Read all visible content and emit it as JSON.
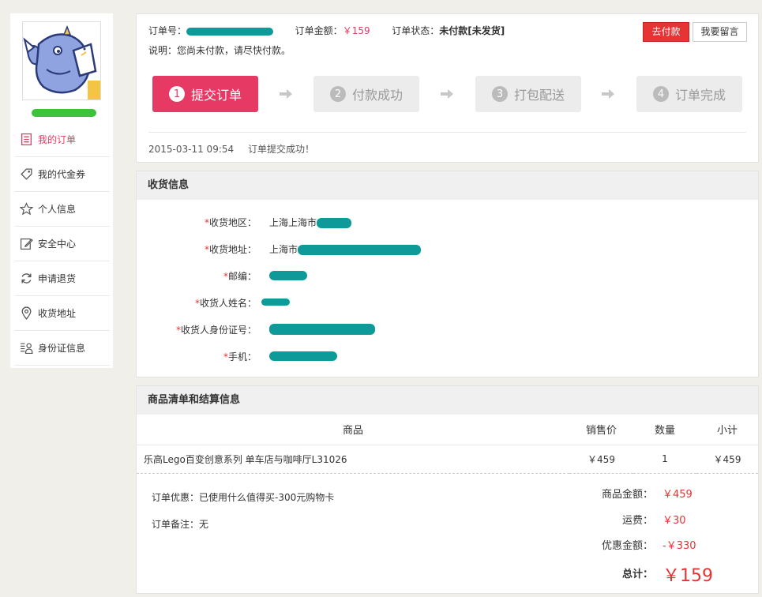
{
  "sidebar": {
    "items": [
      {
        "label": "我的订单",
        "icon": "order-list-icon",
        "active": true
      },
      {
        "label": "我的代金券",
        "icon": "coupon-tag-icon",
        "active": false
      },
      {
        "label": "个人信息",
        "icon": "star-icon",
        "active": false
      },
      {
        "label": "安全中心",
        "icon": "edit-icon",
        "active": false
      },
      {
        "label": "申请退货",
        "icon": "refresh-icon",
        "active": false
      },
      {
        "label": "收货地址",
        "icon": "location-pin-icon",
        "active": false
      },
      {
        "label": "身份证信息",
        "icon": "id-card-icon",
        "active": false
      }
    ]
  },
  "order": {
    "number_label": "订单号：",
    "amount_label": "订单金额：",
    "amount_value": "￥159",
    "status_label": "订单状态：",
    "status_value": "未付款[未发货]",
    "note": "说明：您尚未付款，请尽快付款。",
    "pay_button": "去付款",
    "message_button": "我要留言",
    "steps": [
      {
        "num": "1",
        "label": "提交订单",
        "active": true
      },
      {
        "num": "2",
        "label": "付款成功",
        "active": false
      },
      {
        "num": "3",
        "label": "打包配送",
        "active": false
      },
      {
        "num": "4",
        "label": "订单完成",
        "active": false
      }
    ],
    "log_time": "2015-03-11 09:54",
    "log_text": "订单提交成功！"
  },
  "address": {
    "title": "收货信息",
    "rows": [
      {
        "label": "收货地区：",
        "value": "上海上海市"
      },
      {
        "label": "收货地址：",
        "value": "上海市"
      },
      {
        "label": "邮编：",
        "value": ""
      },
      {
        "label": "收货人姓名：",
        "value": ""
      },
      {
        "label": "收货人身份证号：",
        "value": ""
      },
      {
        "label": "手机：",
        "value": ""
      }
    ]
  },
  "goods": {
    "title": "商品清单和结算信息",
    "headers": {
      "name": "商品",
      "price": "销售价",
      "qty": "数量",
      "subtotal": "小计"
    },
    "rows": [
      {
        "name": "乐高Lego百变创意系列 单车店与咖啡厅L31026",
        "price": "￥459",
        "qty": "1",
        "subtotal": "￥459"
      }
    ],
    "promo": "订单优惠：已使用什么值得买-300元购物卡",
    "remark": "订单备注：无",
    "summary": [
      {
        "label": "商品金额：",
        "value": "￥459"
      },
      {
        "label": "运费：",
        "value": "￥30"
      },
      {
        "label": "优惠金额：",
        "value": "-￥330"
      },
      {
        "label": "总计：",
        "value": "￥159"
      }
    ]
  },
  "colors": {
    "accent": "#e63a65",
    "price_red": "#e63333",
    "redaction": "#0e9a98"
  }
}
